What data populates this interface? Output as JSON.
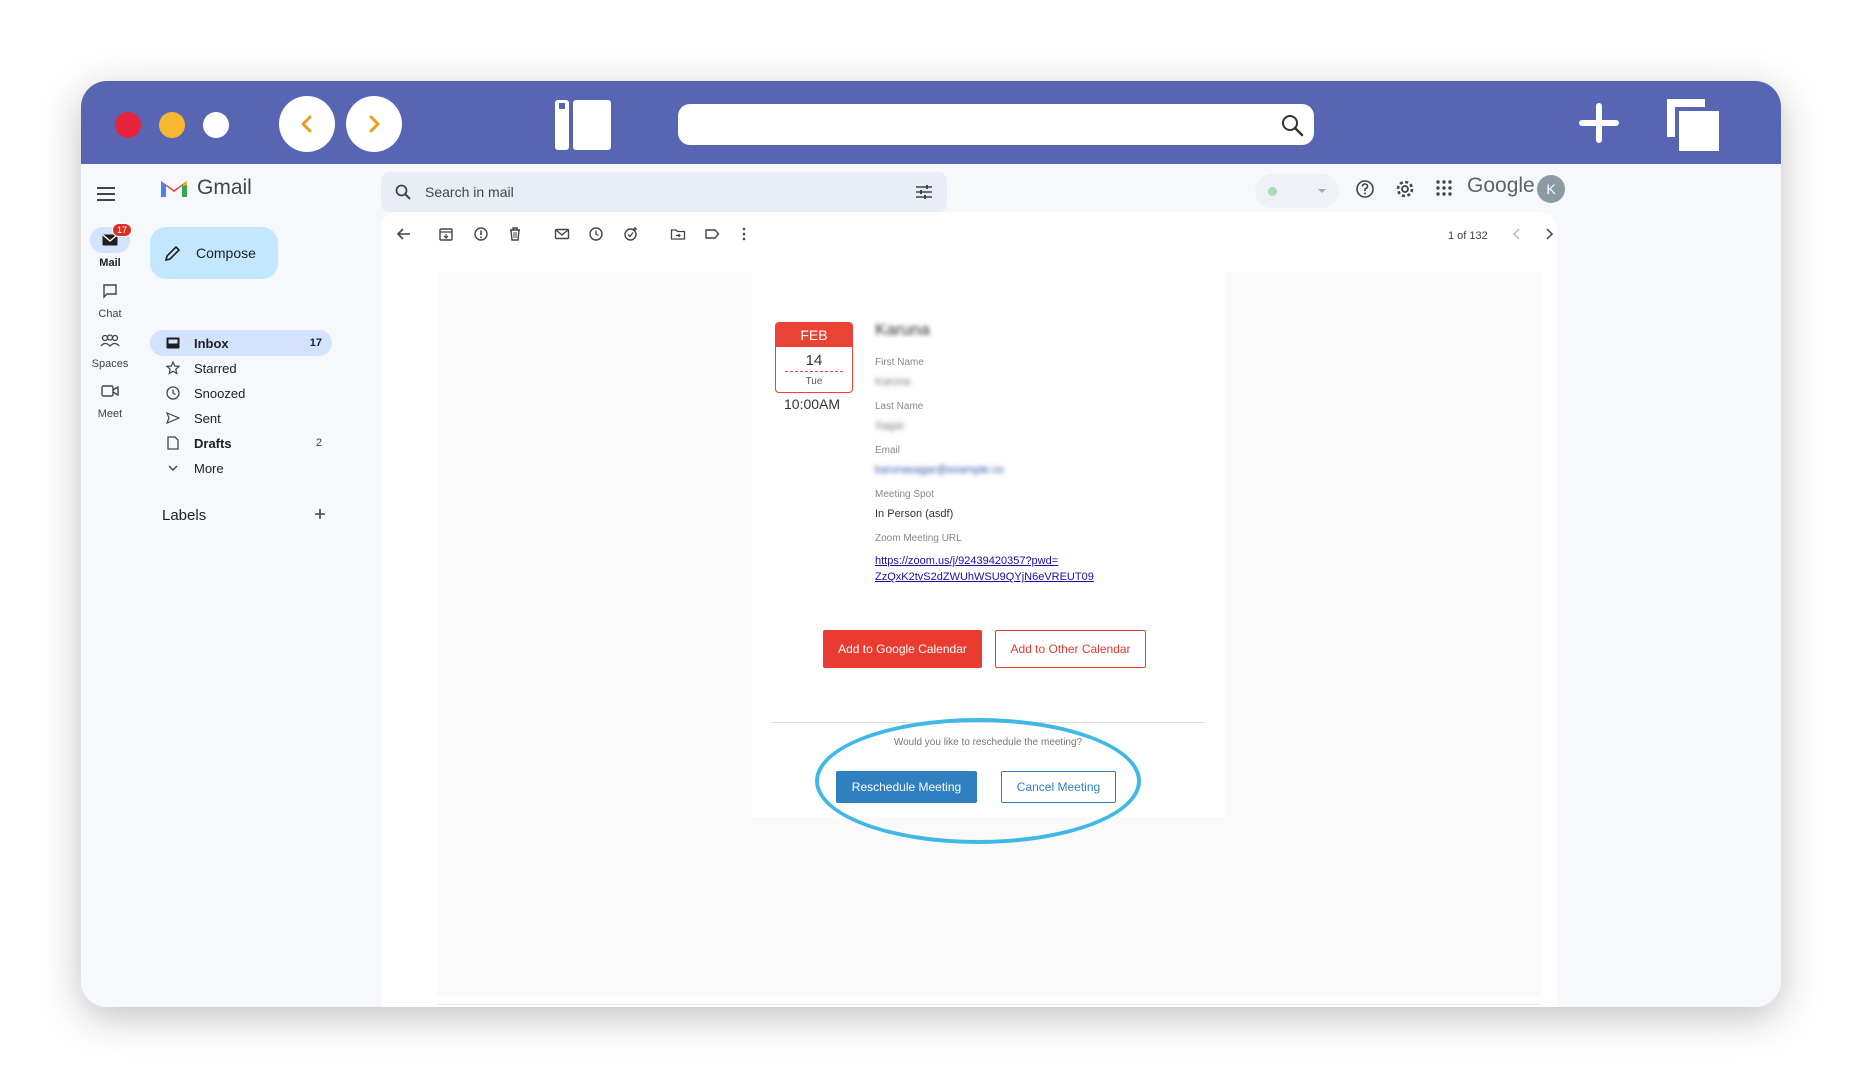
{
  "browser": {
    "colors": {
      "chrome": "#5765b3",
      "close": "#e8243c",
      "minimize": "#f7b731",
      "maximize": "#ffffff",
      "nav_arrow": "#f39a1c"
    },
    "icons": [
      "back-arrow-icon",
      "forward-arrow-icon",
      "sidebar-toggle-icon",
      "search-icon",
      "plus-icon",
      "tabs-icon"
    ]
  },
  "gmail": {
    "logo_text": "Gmail",
    "search_placeholder": "Search in mail",
    "google_word": "Google",
    "avatar_initial": "K",
    "compose_label": "Compose",
    "rail": [
      {
        "label": "Mail",
        "badge": "17",
        "icon": "mail-icon"
      },
      {
        "label": "Chat",
        "icon": "chat-icon"
      },
      {
        "label": "Spaces",
        "icon": "spaces-icon"
      },
      {
        "label": "Meet",
        "icon": "meet-icon"
      }
    ],
    "nav": [
      {
        "label": "Inbox",
        "count": "17",
        "icon": "inbox-icon"
      },
      {
        "label": "Starred",
        "count": "",
        "icon": "star-icon"
      },
      {
        "label": "Snoozed",
        "count": "",
        "icon": "clock-icon"
      },
      {
        "label": "Sent",
        "count": "",
        "icon": "send-icon"
      },
      {
        "label": "Drafts",
        "count": "2",
        "icon": "draft-icon"
      },
      {
        "label": "More",
        "count": "",
        "icon": "chevron-down-icon"
      }
    ],
    "labels_heading": "Labels",
    "pager": "1 of 132"
  },
  "email": {
    "calendar": {
      "month": "FEB",
      "day": "14",
      "weekday": "Tue",
      "time": "10:00AM"
    },
    "name": "Karuna",
    "fields": [
      {
        "label": "First Name",
        "value": "Karuna",
        "blurred": true
      },
      {
        "label": "Last Name",
        "value": "Sagar",
        "blurred": true
      },
      {
        "label": "Email",
        "value": "karunasagar@example.co",
        "blurred": true
      },
      {
        "label": "Meeting Spot",
        "value": "In Person (asdf)",
        "blurred": false
      }
    ],
    "zoom_label": "Zoom Meeting URL",
    "zoom_url_line1": "https://zoom.us/j/92439420357?pwd=",
    "zoom_url_line2": "ZzQxK2tvS2dZWUhWSU9QYjN6eVREUT09",
    "add_google_calendar": "Add to Google Calendar",
    "add_other_calendar": "Add to Other Calendar",
    "reschedule_question": "Would you like to reschedule the meeting?",
    "reschedule_button": "Reschedule Meeting",
    "cancel_button": "Cancel Meeting",
    "colors": {
      "red": "#ea3b30",
      "blue": "#2f7fc1",
      "ring": "#3fb8e6"
    }
  }
}
